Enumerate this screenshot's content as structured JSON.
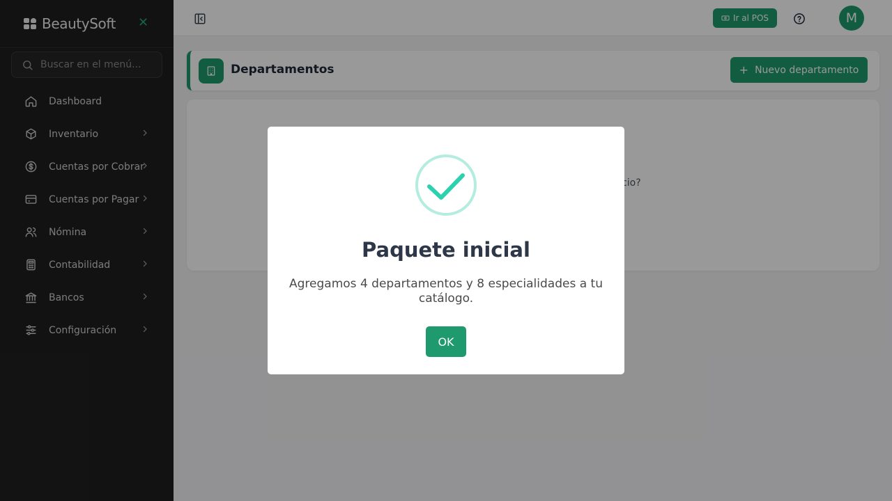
{
  "brand": {
    "name": "BeautySoft",
    "accent_color": "#1f9a6f"
  },
  "sidebar": {
    "close_icon": "close-icon",
    "search": {
      "placeholder": "Buscar en el menú..."
    },
    "items": [
      {
        "label": "Dashboard",
        "icon": "home-icon",
        "has_submenu": false
      },
      {
        "label": "Inventario",
        "icon": "box-icon",
        "has_submenu": true
      },
      {
        "label": "Cuentas por Cobrar",
        "icon": "dollar-circle-icon",
        "has_submenu": true
      },
      {
        "label": "Cuentas por Pagar",
        "icon": "credit-card-icon",
        "has_submenu": true
      },
      {
        "label": "Nómina",
        "icon": "users-icon",
        "has_submenu": true
      },
      {
        "label": "Contabilidad",
        "icon": "calculator-icon",
        "has_submenu": true
      },
      {
        "label": "Bancos",
        "icon": "bank-icon",
        "has_submenu": true
      },
      {
        "label": "Configuración",
        "icon": "sliders-icon",
        "has_submenu": true
      }
    ]
  },
  "topbar": {
    "pos_button": "Ir al POS",
    "avatar_initial": "M"
  },
  "page": {
    "title": "Departamentos",
    "new_button": "Nuevo departamento",
    "card_text_partial": "egocio?"
  },
  "modal": {
    "title": "Paquete inicial",
    "message": "Agregamos 4 departamentos y 8 especialidades a tu catálogo.",
    "ok_button": "OK",
    "icon": "success-check-icon"
  }
}
